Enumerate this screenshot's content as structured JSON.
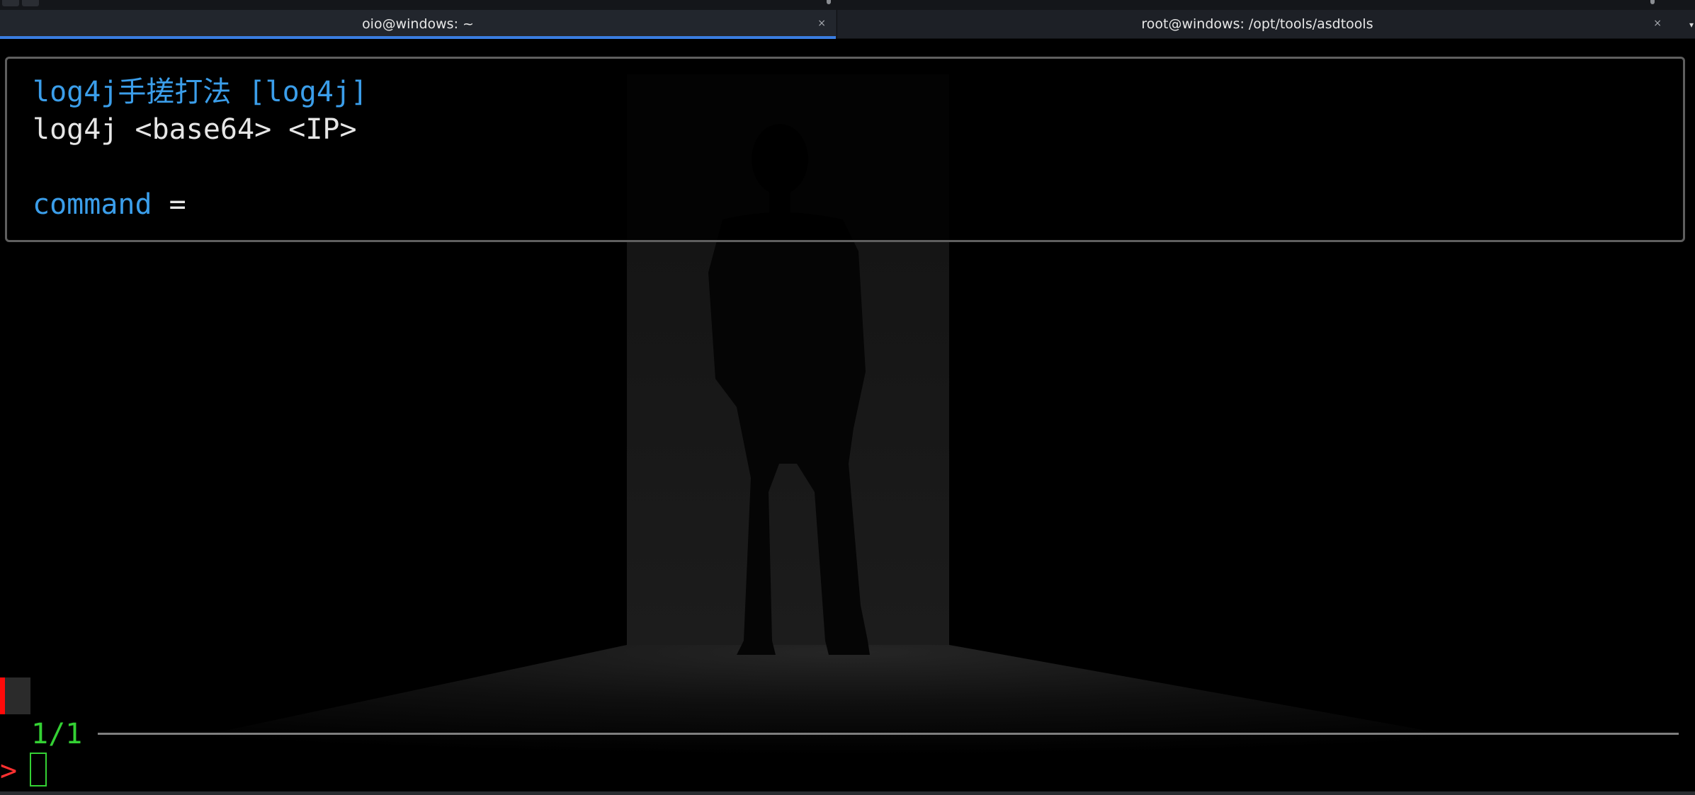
{
  "window": {
    "strip_icon": "app-menu-icon"
  },
  "tabs": [
    {
      "title": "oio@windows: ~",
      "active": true,
      "close_glyph": "×",
      "close_icon": "close-icon"
    },
    {
      "title": "root@windows: /opt/tools/asdtools",
      "active": false,
      "close_glyph": "×",
      "close_icon": "close-icon"
    }
  ],
  "tab_menu": {
    "glyph": "▾",
    "icon": "chevron-down-icon"
  },
  "preview": {
    "title": "log4j手搓打法 [log4j]",
    "usage": "log4j <base64> <IP>",
    "command_key": "command",
    "command_eq": " ="
  },
  "finder": {
    "count": "1/1",
    "prompt": ">",
    "query": ""
  },
  "colors": {
    "accent_blue": "#3b9eea",
    "match_green": "#34d134",
    "prompt_red": "#ff3030",
    "active_tab_underline": "#3a7de0"
  }
}
